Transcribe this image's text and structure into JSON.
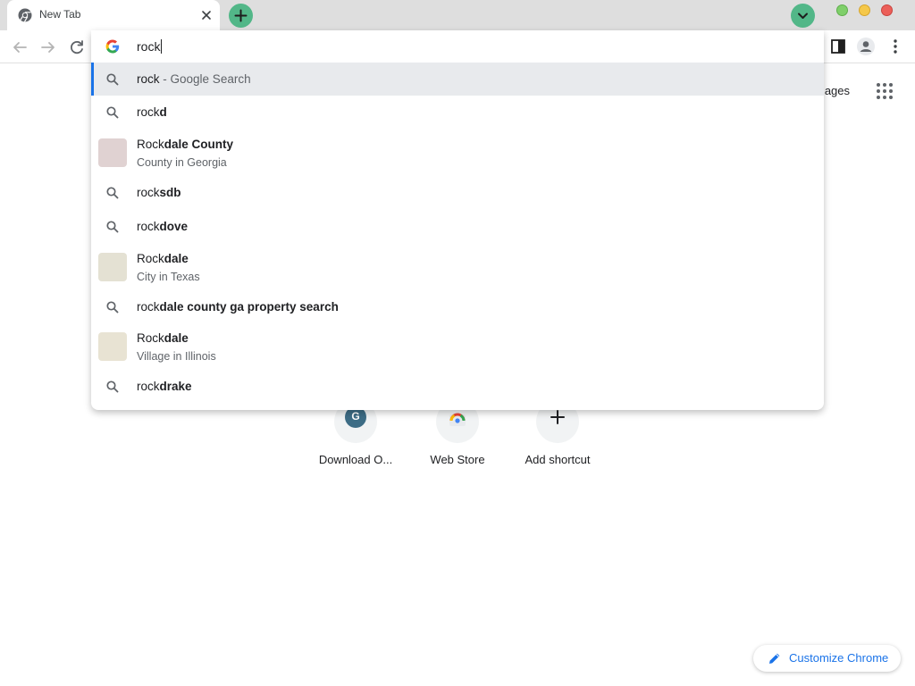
{
  "tab": {
    "title": "New Tab",
    "favicon": "chrome-icon",
    "close_icon": "close-icon"
  },
  "titlebar": {
    "new_tab_icon": "plus-icon",
    "tab_search_icon": "chevron-down-icon",
    "accent_color": "#52b788"
  },
  "toolbar": {
    "back_icon": "back-arrow-icon",
    "forward_icon": "forward-arrow-icon",
    "reload_icon": "reload-icon",
    "side_panel_icon": "side-panel-icon",
    "profile_icon": "profile-icon",
    "menu_icon": "more-vert-icon"
  },
  "omnibox": {
    "value": "rock",
    "engine_icon": "google-icon",
    "suggestions": [
      {
        "type": "search",
        "prefix": "rock",
        "bold": "",
        "desc": "- Google Search",
        "selected": true
      },
      {
        "type": "search",
        "prefix": "rock",
        "bold": "d"
      },
      {
        "type": "entity",
        "prefix": "Rock",
        "bold": "dale County",
        "sub": "County in Georgia",
        "thumb_color": "#e0d2d2"
      },
      {
        "type": "search",
        "prefix": "rock",
        "bold": "sdb"
      },
      {
        "type": "search",
        "prefix": "rock",
        "bold": "dove"
      },
      {
        "type": "entity",
        "prefix": "Rock",
        "bold": "dale",
        "sub": "City in Texas",
        "thumb_color": "#e4e1d3"
      },
      {
        "type": "search",
        "prefix": "rock",
        "bold": "dale county ga property search"
      },
      {
        "type": "entity",
        "prefix": "Rock",
        "bold": "dale",
        "sub": "Village in Illinois",
        "thumb_color": "#e8e3d3"
      },
      {
        "type": "search",
        "prefix": "rock",
        "bold": "drake"
      }
    ],
    "highlight_color": "#1a73e8"
  },
  "ntp": {
    "images_link": "mages",
    "apps_icon": "apps-grid-icon",
    "shortcuts": [
      {
        "label": "Download O...",
        "icon": "g-letter-icon",
        "icon_letter": "G",
        "icon_color": "#3d6c85"
      },
      {
        "label": "Web Store",
        "icon": "web-store-icon"
      },
      {
        "label": "Add shortcut",
        "icon": "plus-icon"
      }
    ],
    "customize_label": "Customize Chrome",
    "customize_icon": "pencil-icon"
  }
}
